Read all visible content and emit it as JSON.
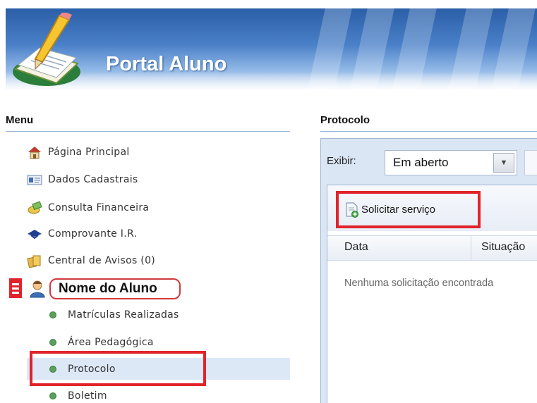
{
  "header": {
    "title": "Portal Aluno"
  },
  "sidebar": {
    "title": "Menu",
    "items": [
      {
        "label": "Página Principal",
        "icon": "home-icon"
      },
      {
        "label": "Dados Cadastrais",
        "icon": "id-card-icon"
      },
      {
        "label": "Consulta Financeira",
        "icon": "money-icon"
      },
      {
        "label": "Comprovante I.R.",
        "icon": "federal-revenue-icon"
      },
      {
        "label": "Central de Avisos (0)",
        "icon": "notes-icon"
      }
    ],
    "student": {
      "name": "Nome do Aluno"
    },
    "subitems": [
      {
        "label": "Matrículas Realizadas"
      },
      {
        "label": "Área Pedagógica"
      },
      {
        "label": "Protocolo",
        "selected": true
      },
      {
        "label": "Boletim"
      }
    ]
  },
  "main": {
    "title": "Protocolo",
    "filter": {
      "label": "Exibir:",
      "selected": "Em aberto"
    },
    "toolbar": {
      "request_button": "Solicitar serviço"
    },
    "table": {
      "columns": [
        "Data",
        "Situação"
      ],
      "empty_message": "Nenhuma solicitação encontrada"
    }
  },
  "colors": {
    "highlight_red": "#e1232c",
    "selected_row": "#dde8f7",
    "banner_blue": "#2a5fa8"
  }
}
